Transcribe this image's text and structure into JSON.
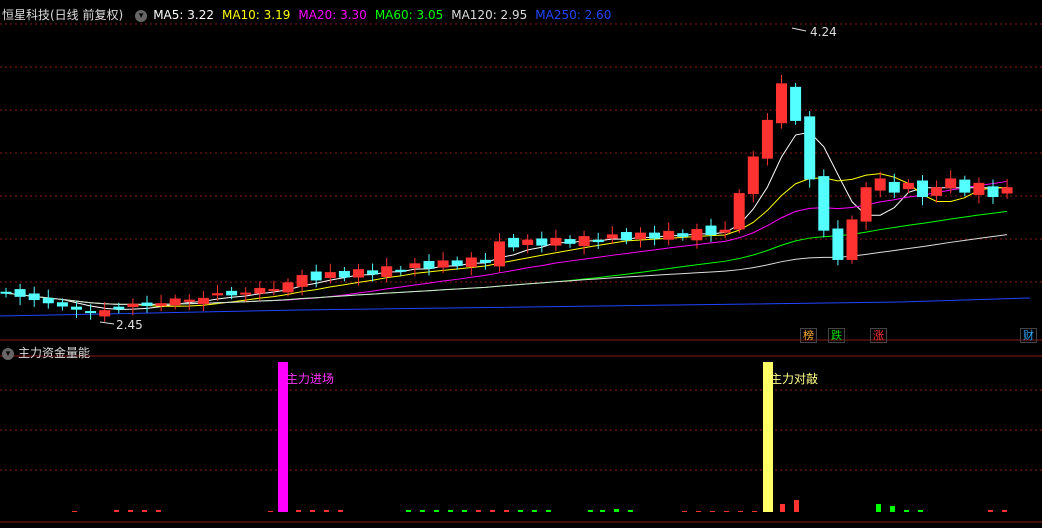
{
  "header": {
    "title": "恒星科技(日线 前复权)",
    "ma": [
      {
        "label": "MA5:",
        "value": "3.22",
        "color": "#ffffff"
      },
      {
        "label": "MA10:",
        "value": "3.19",
        "color": "#ffff00"
      },
      {
        "label": "MA20:",
        "value": "3.30",
        "color": "#ff00ff"
      },
      {
        "label": "MA60:",
        "value": "3.05",
        "color": "#00ff00"
      },
      {
        "label": "MA120:",
        "value": "2.95",
        "color": "#dddddd"
      },
      {
        "label": "MA250:",
        "value": "2.60",
        "color": "#2244ff"
      }
    ]
  },
  "price_marks": {
    "high": "4.24",
    "low": "2.45"
  },
  "event_tags": [
    {
      "text": "榜",
      "color": "#ffaa33"
    },
    {
      "text": "跌",
      "color": "#00dd00"
    },
    {
      "text": "涨",
      "color": "#ff3333"
    },
    {
      "text": "财",
      "color": "#33aaff"
    }
  ],
  "sub_panel": {
    "title": "主力资金量能",
    "signal_in": "主力进场",
    "signal_out": "主力对敲"
  },
  "colors": {
    "up": "#ff3232",
    "down": "#54ffff",
    "signal_in": "#ff00ff",
    "signal_out": "#ffff66"
  }
}
